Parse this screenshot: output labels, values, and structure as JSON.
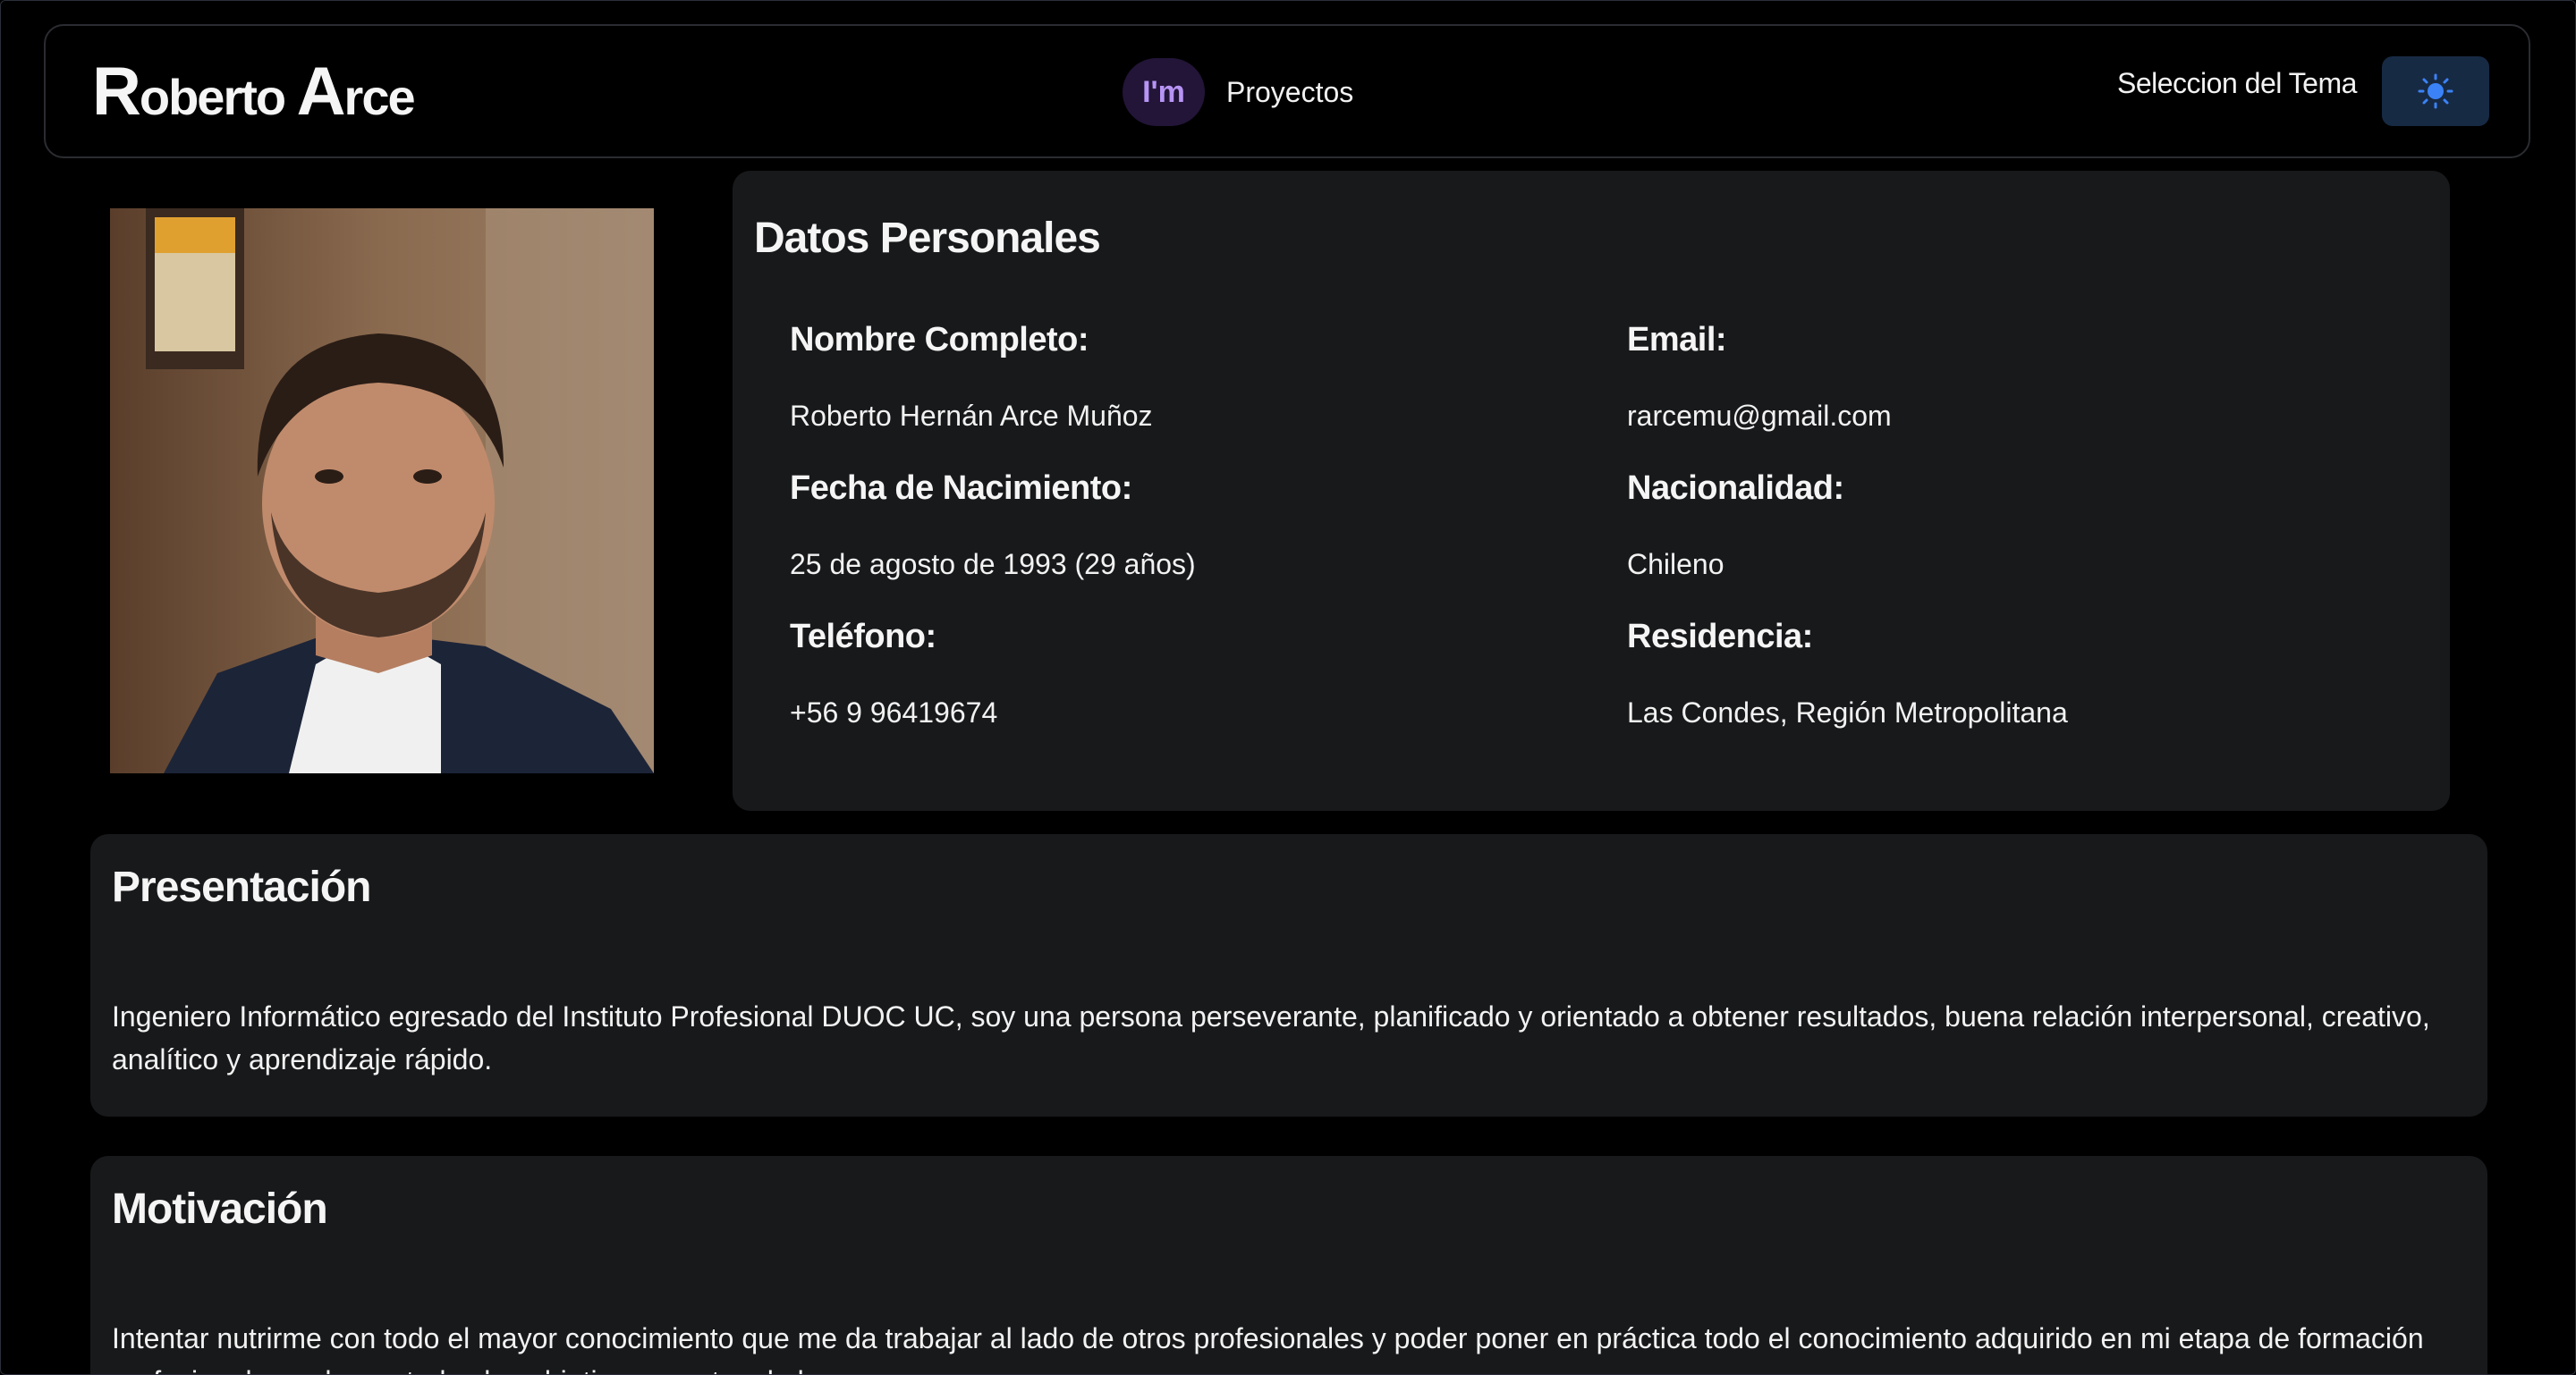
{
  "header": {
    "brand_first_initial": "R",
    "brand_first_rest": "oberto ",
    "brand_last_initial": "A",
    "brand_last_rest": "rce",
    "avatar_text": "I'm",
    "nav_projects": "Proyectos",
    "theme_label": "Seleccion del Tema",
    "theme_icon": "sun-icon"
  },
  "datos": {
    "title": "Datos Personales",
    "fields": [
      {
        "label": "Nombre Completo:",
        "value": "Roberto Hernán Arce Muñoz"
      },
      {
        "label": "Email:",
        "value": "rarcemu@gmail.com"
      },
      {
        "label": "Fecha de Nacimiento:",
        "value": "25 de agosto de 1993 (29 años)"
      },
      {
        "label": "Nacionalidad:",
        "value": "Chileno"
      },
      {
        "label": "Teléfono:",
        "value": "+56 9 96419674"
      },
      {
        "label": "Residencia:",
        "value": "Las Condes, Región Metropolitana"
      }
    ]
  },
  "presentacion": {
    "title": "Presentación",
    "text": "Ingeniero Informático egresado del Instituto Profesional DUOC UC, soy una persona perseverante, planificado y orientado a obtener resultados, buena relación interpersonal, creativo, analítico y aprendizaje rápido."
  },
  "motivacion": {
    "title": "Motivación",
    "text": "Intentar nutrirme con todo el mayor conocimiento que me da trabajar al lado de otros profesionales y poder poner en práctica todo el conocimiento adquirido en mi etapa de formación profesional para lograr todos los objetivos y metas de la empresa."
  },
  "colors": {
    "background": "#000000",
    "card": "#18191b",
    "accent": "#3b82f6",
    "avatar_text": "#b794f4"
  }
}
